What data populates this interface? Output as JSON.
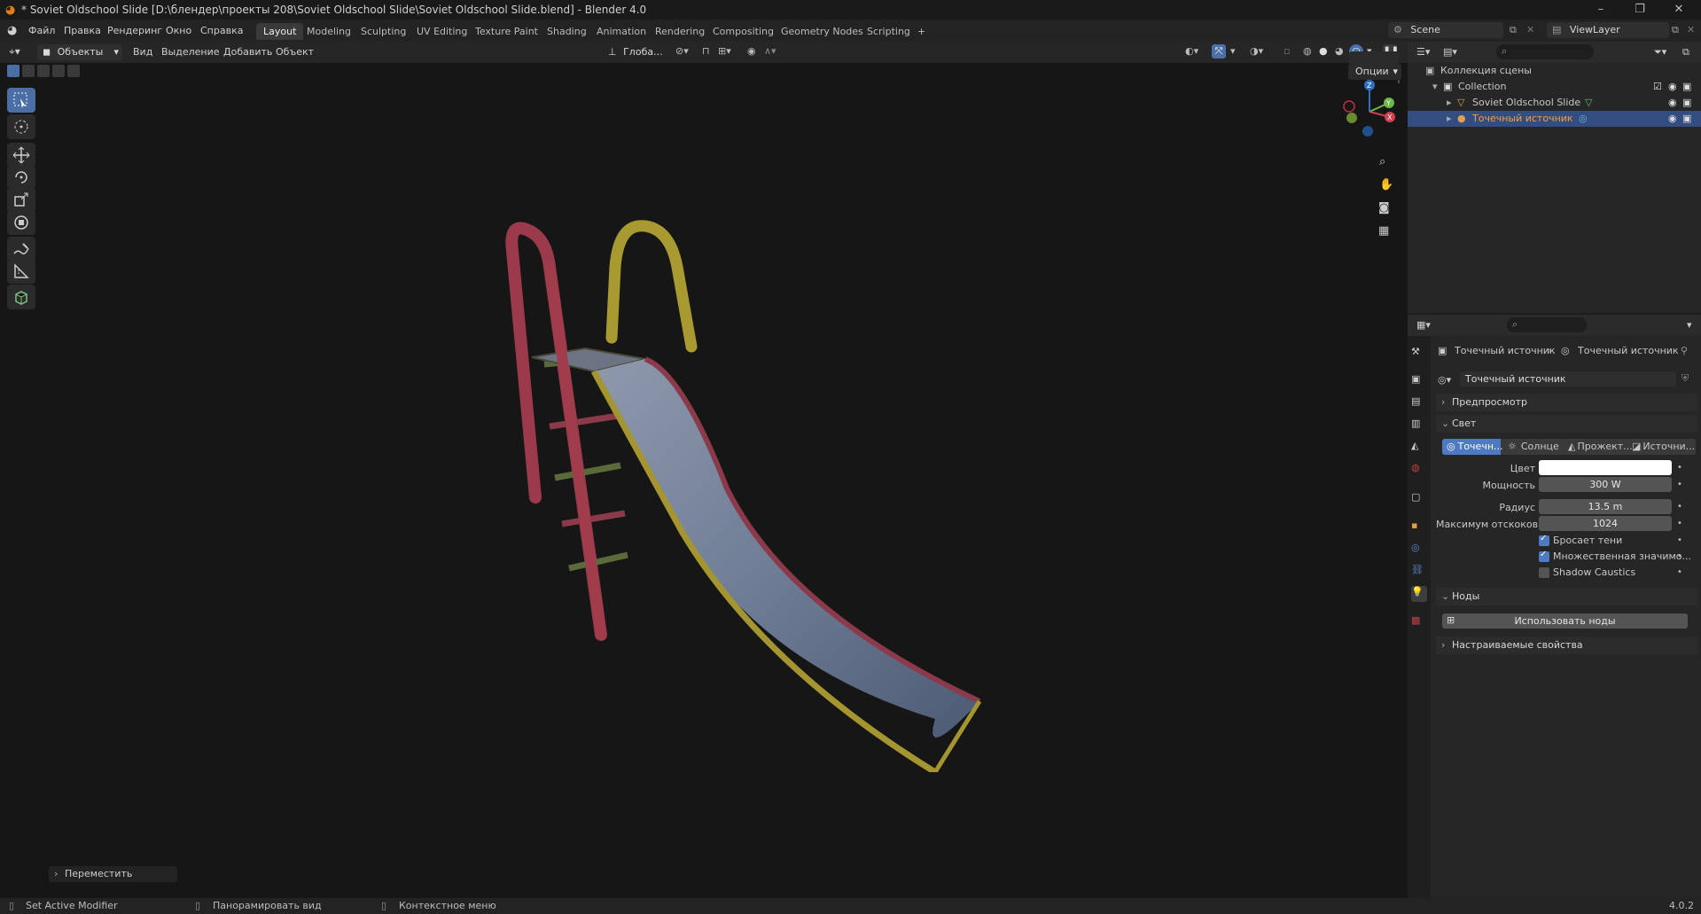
{
  "window": {
    "title": "* Soviet Oldschool Slide [D:\\блендер\\проекты 208\\Soviet Oldschool Slide\\Soviet Oldschool Slide.blend] - Blender 4.0"
  },
  "menu": {
    "items": [
      "Файл",
      "Правка",
      "Рендеринг",
      "Окно",
      "Справка"
    ]
  },
  "workspaces": [
    "Layout",
    "Modeling",
    "Sculpting",
    "UV Editing",
    "Texture Paint",
    "Shading",
    "Animation",
    "Rendering",
    "Compositing",
    "Geometry Nodes",
    "Scripting",
    "+"
  ],
  "scene": {
    "name": "Scene",
    "view_layer": "ViewLayer"
  },
  "viewport": {
    "mode": "Объекты",
    "menus": [
      "Вид",
      "Выделение",
      "Добавить",
      "Объект"
    ],
    "orientation": "Глоба...",
    "options": "Опции",
    "last_operator": "Переместить"
  },
  "outliner": {
    "root": "Коллекция сцены",
    "collection": "Collection",
    "items": [
      {
        "name": "Soviet Oldschool Slide",
        "selected": false
      },
      {
        "name": "Точечный источник",
        "selected": true
      }
    ]
  },
  "properties": {
    "breadcrumb": [
      "Точечный источник",
      "Точечный источник"
    ],
    "datablock": "Точечный источник",
    "sections": {
      "preview": "Предпросмотр",
      "light": "Свет",
      "nodes": "Ноды",
      "custom": "Настраиваемые свойства"
    },
    "light_types": [
      "Точечн...",
      "Солнце",
      "Прожект...",
      "Источни..."
    ],
    "fields": {
      "color_label": "Цвет",
      "power_label": "Мощность",
      "power_value": "300 W",
      "radius_label": "Радиус",
      "radius_value": "13.5 m",
      "bounces_label": "Максимум отскоков",
      "bounces_value": "1024"
    },
    "checkboxes": [
      {
        "label": "Бросает тени",
        "checked": true
      },
      {
        "label": "Множественная значимо...",
        "checked": true
      },
      {
        "label": "Shadow Caustics",
        "checked": false
      }
    ],
    "use_nodes": "Использовать ноды"
  },
  "status": {
    "left": "Set Active Modifier",
    "middle": "Панорамировать вид",
    "right": "Контекстное меню",
    "version": "4.0.2"
  }
}
